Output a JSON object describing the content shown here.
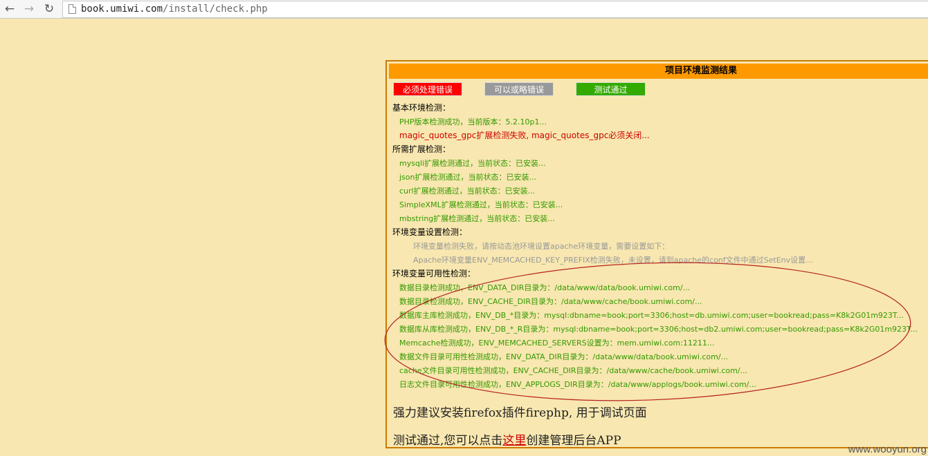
{
  "browser": {
    "url_host": "book.umiwi.com",
    "url_path": "/install/check.php"
  },
  "panel": {
    "title": "项目环境监测结果",
    "legend": {
      "error": "必须处理错误",
      "ignorable": "可以或略错误",
      "passed": "测试通过"
    },
    "colors": {
      "error": "#ff0000",
      "ignorable": "#999999",
      "passed": "#33aa00",
      "header": "#ff9900"
    }
  },
  "sections": {
    "basic": {
      "title": "基本环境检测：",
      "php": "PHP版本检测成功，当前版本：5.2.10p1...",
      "magic": "magic_quotes_gpc扩展检测失败, magic_quotes_gpc必须关闭..."
    },
    "ext": {
      "title": "所需扩展检测：",
      "mysqli": "mysqli扩展检测通过，当前状态：已安装...",
      "json": "json扩展检测通过，当前状态：已安装...",
      "curl": "curl扩展检测通过，当前状态：已安装...",
      "simplexml": "SimpleXML扩展检测通过，当前状态：已安装...",
      "mbstring": "mbstring扩展检测通过，当前状态：已安装..."
    },
    "envset": {
      "title": "环境变量设置检测：",
      "fail": "环境变量检测失败，请按动态池环境设置apache环境变量，需要设置如下：",
      "apache": "Apache环境变量ENV_MEMCACHED_KEY_PREFIX检测失败，未设置，请到apache的conf文件中通过SetEnv设置..."
    },
    "envavail": {
      "title": "环境变量可用性检测：",
      "data_dir": "数据目录检测成功，ENV_DATA_DIR目录为：/data/www/data/book.umiwi.com/...",
      "cache_dir": "数据目录检测成功，ENV_CACHE_DIR目录为：/data/www/cache/book.umiwi.com/...",
      "db_master": "数据库主库检测成功，ENV_DB_*目录为：mysql:dbname=book;port=3306;host=db.umiwi.com;user=bookread;pass=K8k2G01m923T...",
      "db_slave": "数据库从库检测成功，ENV_DB_*_R目录为：mysql:dbname=book;port=3306;host=db2.umiwi.com;user=bookread;pass=K8k2G01m923T...",
      "memcache": "Memcache检测成功，ENV_MEMCACHED_SERVERS设置为：mem.umiwi.com:11211...",
      "data_file": "数据文件目录可用性检测成功，ENV_DATA_DIR目录为：/data/www/data/book.umiwi.com/...",
      "cache_file": "cache文件目录可用性检测成功，ENV_CACHE_DIR目录为：/data/www/cache/book.umiwi.com/...",
      "log_file": "日志文件目录可用性检测成功，ENV_APPLOGS_DIR目录为：/data/www/applogs/book.umiwi.com/..."
    }
  },
  "footer": {
    "firephp": "强力建议安装firefox插件firephp, 用于调试页面",
    "passed_prefix": "测试通过,您可以点击",
    "link": "这里",
    "passed_suffix": "创建管理后台APP"
  },
  "watermark": "www.wooyun.org"
}
